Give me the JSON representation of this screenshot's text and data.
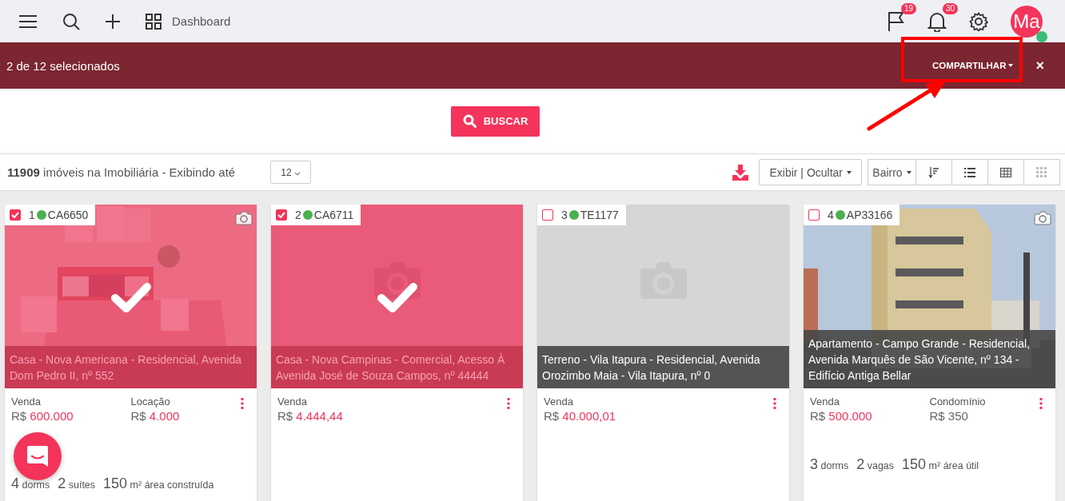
{
  "topbar": {
    "dashboard_label": "Dashboard",
    "flag_badge": "19",
    "bell_badge": "30",
    "avatar_initials": "Ma",
    "avatar_online": true
  },
  "selection_bar": {
    "count_text": "2 de 12 selecionados",
    "share_label": "COMPARTILHAR",
    "close_label": "×"
  },
  "search": {
    "button_label": "BUSCAR"
  },
  "toolbar": {
    "summary": "**11909** imóveis na Imobiliária - Exibindo até",
    "page_size": "12",
    "toggle_label": "Exibir | Ocultar",
    "sort_label": "Bairro"
  },
  "cards": [
    {
      "number": "1",
      "code": "CA6650",
      "selected": true,
      "title": "Casa - Nova Americana - Residencial, Avenida Dom Pedro II, nº 552",
      "prices": [
        {
          "label": "Venda",
          "currency": "R$",
          "value": "600.000",
          "accent": true
        },
        {
          "label": "Locação",
          "currency": "R$",
          "value": "4.000",
          "accent": true
        }
      ],
      "features": [
        {
          "count": "4",
          "unit": "dorms"
        },
        {
          "count": "2",
          "unit": "suítes"
        },
        {
          "count": "150",
          "unit": "m² área construída"
        }
      ]
    },
    {
      "number": "2",
      "code": "CA6711",
      "selected": true,
      "kind": "empty",
      "title": "Casa - Nova Campinas - Comercial, Acesso À Avenida José de Souza Campos, nº 44444",
      "prices": [
        {
          "label": "Venda",
          "currency": "R$",
          "value": "4.444,44",
          "accent": true
        }
      ]
    },
    {
      "number": "3",
      "code": "TE1177",
      "selected": false,
      "kind": "empty",
      "title": "Terreno - Vila Itapura - Residencial, Avenida Orozimbo Maia - Vila Itapura, nº 0",
      "prices": [
        {
          "label": "Venda",
          "currency": "R$",
          "value": "40.000,01",
          "accent": true
        }
      ]
    },
    {
      "number": "4",
      "code": "AP33166",
      "selected": false,
      "title": "Apartamento - Campo Grande - Residencial, Avenida Marquês de São Vicente, nº 134 - Edifício Antiga Bellar",
      "prices": [
        {
          "label": "Venda",
          "currency": "R$",
          "value": "500.000",
          "accent": true
        },
        {
          "label": "Condomínio",
          "currency": "R$",
          "value": "350",
          "accent": false
        }
      ],
      "features": [
        {
          "count": "3",
          "unit": "dorms"
        },
        {
          "count": "2",
          "unit": "vagas"
        },
        {
          "count": "150",
          "unit": "m² área útil"
        }
      ]
    }
  ]
}
